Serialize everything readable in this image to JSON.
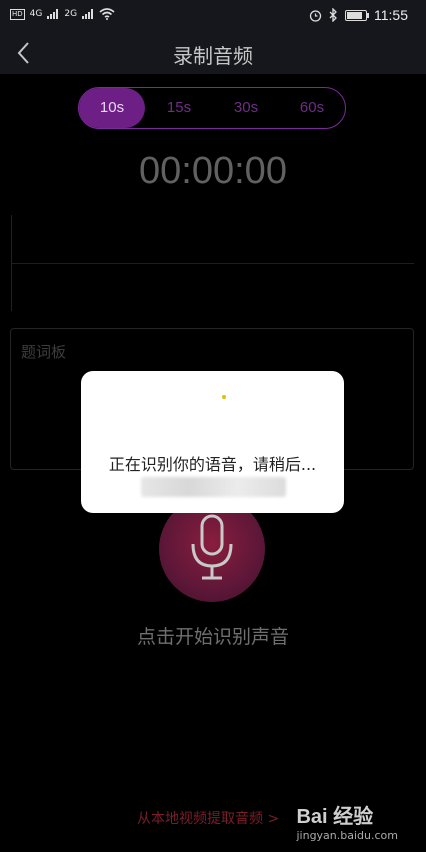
{
  "status_bar": {
    "network_labels": [
      "HD",
      "4G",
      "2G"
    ],
    "time": "11:55"
  },
  "header": {
    "title": "录制音频"
  },
  "duration_options": [
    {
      "label": "10s",
      "active": true
    },
    {
      "label": "15s",
      "active": false
    },
    {
      "label": "30s",
      "active": false
    },
    {
      "label": "60s",
      "active": false
    }
  ],
  "timer": "00:00:00",
  "prompt_board": {
    "placeholder": "题词板"
  },
  "mic": {
    "label": "点击开始识别声音"
  },
  "dialog": {
    "message": "正在识别你的语音，请稍后..."
  },
  "bottom_link": "从本地视频提取音频 >",
  "watermark": {
    "brand": "Bai 经验",
    "url": "jingyan.baidu.com"
  },
  "colors": {
    "accent_purple": "#6d1f86",
    "link_red": "#7a1e2a",
    "mic_gradient": "#8a1d3e"
  },
  "icons": [
    "back-arrow",
    "microphone",
    "wifi",
    "alarm",
    "bluetooth",
    "battery"
  ]
}
